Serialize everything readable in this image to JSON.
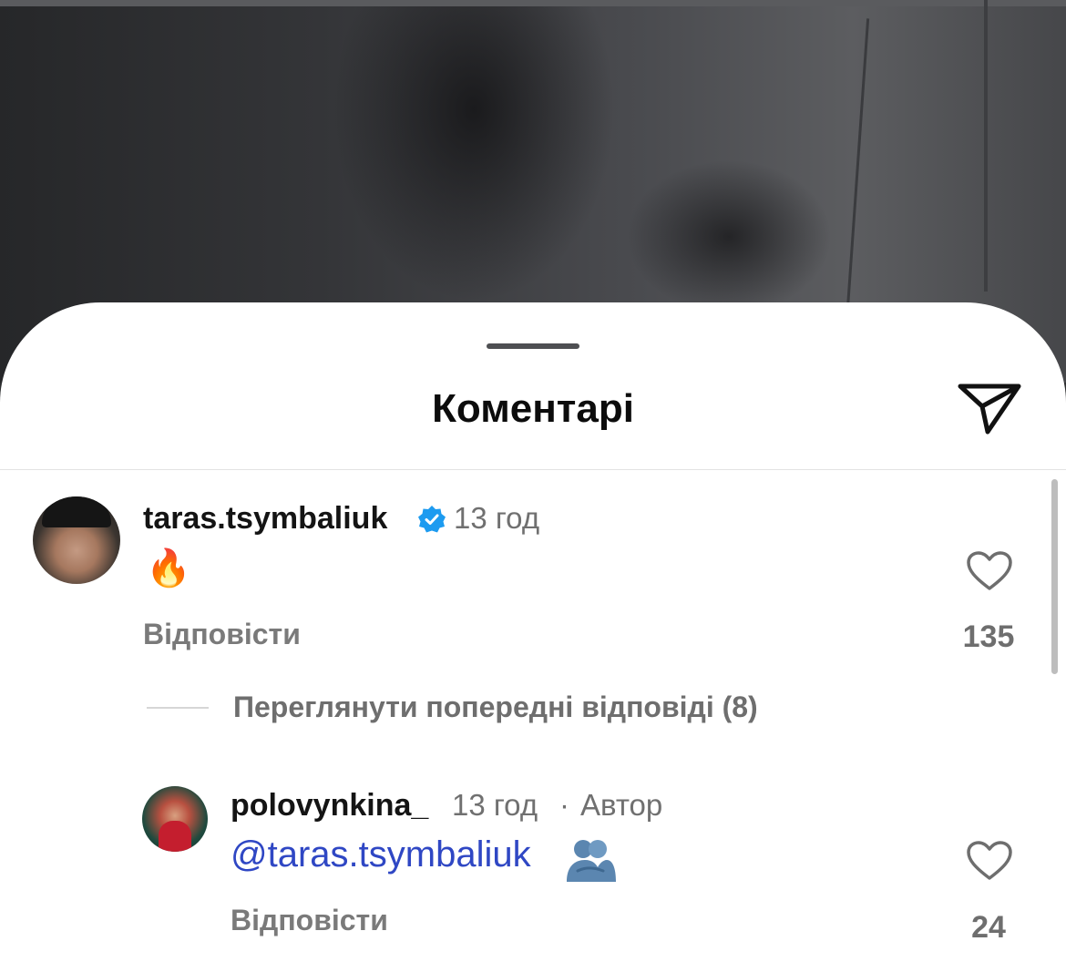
{
  "sheet": {
    "title": "Коментарі",
    "send_icon": "send-paper-plane-icon"
  },
  "comments": [
    {
      "username": "taras.tsymbaliuk",
      "verified": true,
      "time": "13 год",
      "text": "🔥",
      "reply_label": "Відповісти",
      "likes": "135"
    }
  ],
  "thread": {
    "view_previous": "Переглянути попередні відповіді (8)"
  },
  "replies": [
    {
      "username": "polovynkina_",
      "time": "13 год",
      "separator": "·",
      "author_badge": "Автор",
      "mention": "@taras.tsymbaliuk",
      "emoji_icon": "people-hugging-icon",
      "reply_label": "Відповісти",
      "likes": "24"
    }
  ],
  "colors": {
    "mention": "#2f47c4",
    "verified": "#1d9bf0",
    "muted": "#707070"
  }
}
